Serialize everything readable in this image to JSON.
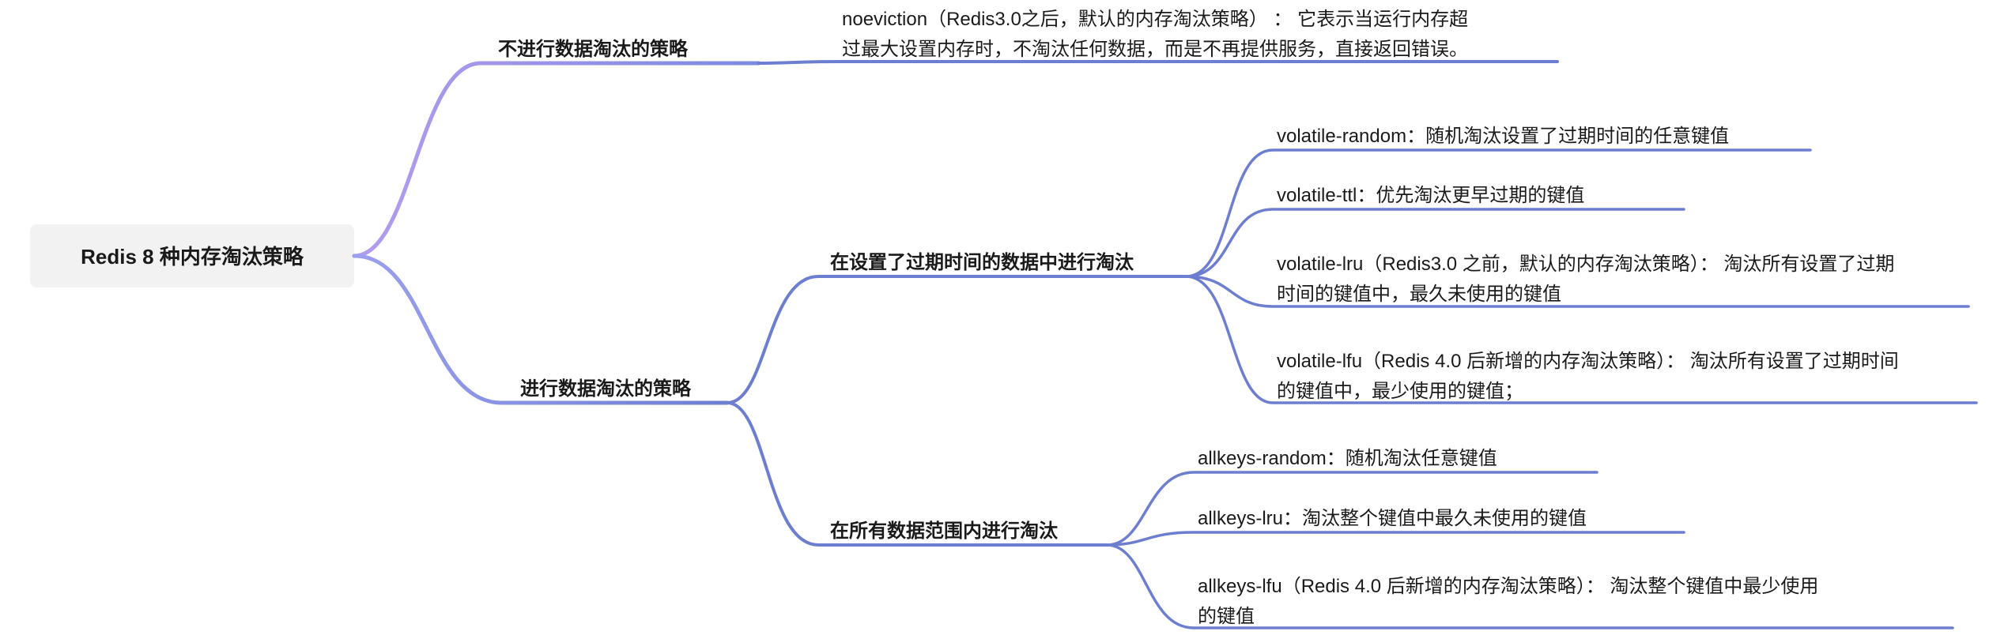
{
  "root": {
    "label": "Redis 8 种内存淘汰策略"
  },
  "branches": {
    "no_evict": {
      "label": "不进行数据淘汰的策略"
    },
    "evict": {
      "label": "进行数据淘汰的策略"
    }
  },
  "subs": {
    "volatile": {
      "label": "在设置了过期时间的数据中进行淘汰"
    },
    "allkeys": {
      "label": "在所有数据范围内进行淘汰"
    }
  },
  "leaves": {
    "noeviction_l1": "noeviction（Redis3.0之后，默认的内存淘汰策略） ： 它表示当运行内存超",
    "noeviction_l2": "过最大设置内存时，不淘汰任何数据，而是不再提供服务，直接返回错误。",
    "vol_random": "volatile-random：随机淘汰设置了过期时间的任意键值",
    "vol_ttl": "volatile-ttl：优先淘汰更早过期的键值",
    "vol_lru_l1": "volatile-lru（Redis3.0 之前，默认的内存淘汰策略）： 淘汰所有设置了过期",
    "vol_lru_l2": "时间的键值中，最久未使用的键值",
    "vol_lfu_l1": "volatile-lfu（Redis 4.0 后新增的内存淘汰策略）： 淘汰所有设置了过期时间",
    "vol_lfu_l2": "的键值中，最少使用的键值；",
    "all_random": "allkeys-random：随机淘汰任意键值",
    "all_lru": "allkeys-lru：淘汰整个键值中最久未使用的键值",
    "all_lfu_l1": "allkeys-lfu（Redis 4.0 后新增的内存淘汰策略）： 淘汰整个键值中最少使用",
    "all_lfu_l2": "的键值"
  }
}
